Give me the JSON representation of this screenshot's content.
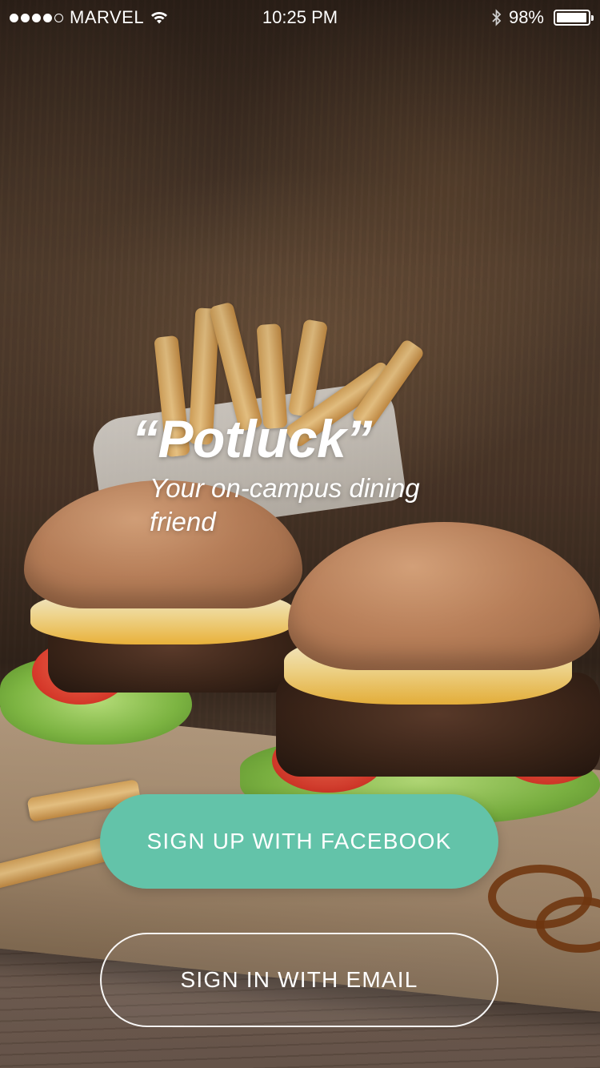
{
  "status_bar": {
    "signal_dots_filled": 4,
    "signal_dots_total": 5,
    "carrier": "MARVEL",
    "time": "10:25 PM",
    "battery_percent": "98%",
    "battery_level": 0.98,
    "icons": [
      "wifi-icon",
      "bluetooth-icon",
      "battery-icon"
    ]
  },
  "hero": {
    "title": "“Potluck”",
    "tagline": "Your on-campus dining friend"
  },
  "actions": {
    "facebook_label": "SIGN UP WITH FACEBOOK",
    "email_label": "SIGN IN WITH EMAIL"
  },
  "colors": {
    "accent": "#63c3a9",
    "text": "#ffffff"
  }
}
